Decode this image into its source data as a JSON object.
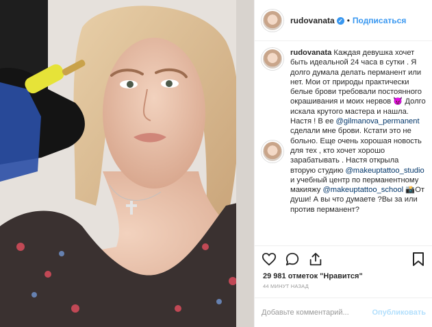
{
  "post": {
    "username": "rudovanata",
    "follow_label": "Подписаться",
    "separator": "•"
  },
  "caption": {
    "username": "rudovanata",
    "text_part1": " Каждая девушка хочет быть идеальной 24 часа в сутки . Я долго думала делать перманент или нет. Мои от природы практически белые брови требовали постоянного окрашивания и моих нервов ",
    "emoji1": "😈",
    "text_part2": " Долго искала крутого мастера и нашла. Настя ! В ее ",
    "mention1": "@gilmanova_permanent",
    "text_part3": " сделали мне брови. Кстати это не больно. Еще очень хорошая новость для тех , кто хочет хорошо зарабатывать . Настя открыла вторую студию ",
    "mention2": "@makeuptattoo_studio",
    "text_part4": " и учебный центр по перманентному макияжу ",
    "mention3": "@makeuptattoo_school",
    "emoji2": "📸",
    "text_part5": "От души! А вы что думаете ?Вы за или против перманент?"
  },
  "stats": {
    "likes": "29 981 отметок \"Нравится\"",
    "time": "44 МИНУТ НАЗАД"
  },
  "comment_box": {
    "placeholder": "Добавьте комментарий...",
    "publish_label": "Опубликовать"
  },
  "icons": {
    "like": "heart-icon",
    "comment": "comment-icon",
    "share": "share-icon",
    "save": "bookmark-icon",
    "verified": "verified-icon"
  },
  "colors": {
    "link": "#3897f0",
    "mention": "#003569",
    "publish_disabled": "#b2dffc"
  }
}
